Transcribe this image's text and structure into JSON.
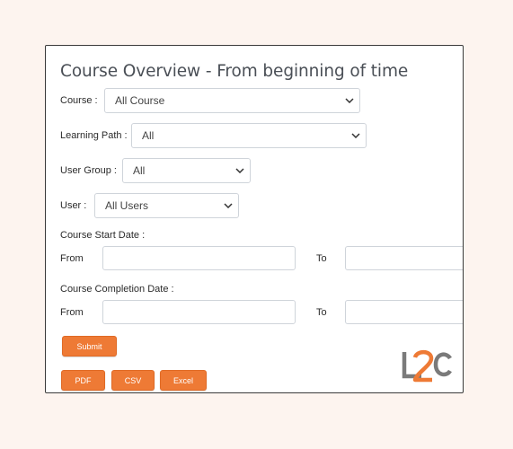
{
  "page": {
    "title": "Course Overview - From beginning of time"
  },
  "filters": {
    "course": {
      "label": "Course :",
      "value": "All Course"
    },
    "learning_path": {
      "label": "Learning Path :",
      "value": "All"
    },
    "user_group": {
      "label": "User Group :",
      "value": "All"
    },
    "user": {
      "label": "User :",
      "value": "All Users"
    }
  },
  "course_start_date": {
    "label": "Course Start Date :",
    "from_label": "From",
    "from_value": "",
    "to_label": "To",
    "to_value": ""
  },
  "course_completion_date": {
    "label": "Course Completion Date :",
    "from_label": "From",
    "from_value": "",
    "to_label": "To",
    "to_value": ""
  },
  "actions": {
    "submit": "Submit",
    "pdf": "PDF",
    "csv": "CSV",
    "excel": "Excel"
  },
  "logo": {
    "text": "L2C"
  },
  "colors": {
    "accent": "#ee7a35",
    "logo_gray": "#7a7a7a",
    "logo_orange": "#ee7a35",
    "page_bg": "#fdf4ef"
  }
}
